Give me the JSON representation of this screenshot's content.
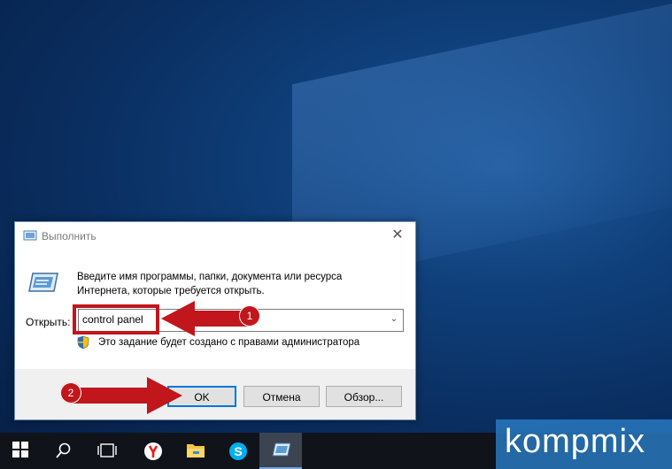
{
  "dialog": {
    "title": "Выполнить",
    "close_glyph": "✕",
    "description_line1": "Введите имя программы, папки, документа или ресурса",
    "description_line2": "Интернета, которые требуется открыть.",
    "open_label": "Открыть:",
    "open_value": "control panel",
    "admin_note": "Это задание будет создано с правами администратора",
    "buttons": {
      "ok": "OK",
      "cancel": "Отмена",
      "browse": "Обзор..."
    }
  },
  "annotations": {
    "step1": "1",
    "step2": "2",
    "accent": "#c0161c"
  },
  "taskbar": {
    "items": [
      "windows-start-icon",
      "search-icon",
      "task-view-icon",
      "yandex-browser-icon",
      "file-explorer-icon",
      "skype-icon",
      "run-icon"
    ]
  },
  "watermark": {
    "text": "kompmix"
  }
}
